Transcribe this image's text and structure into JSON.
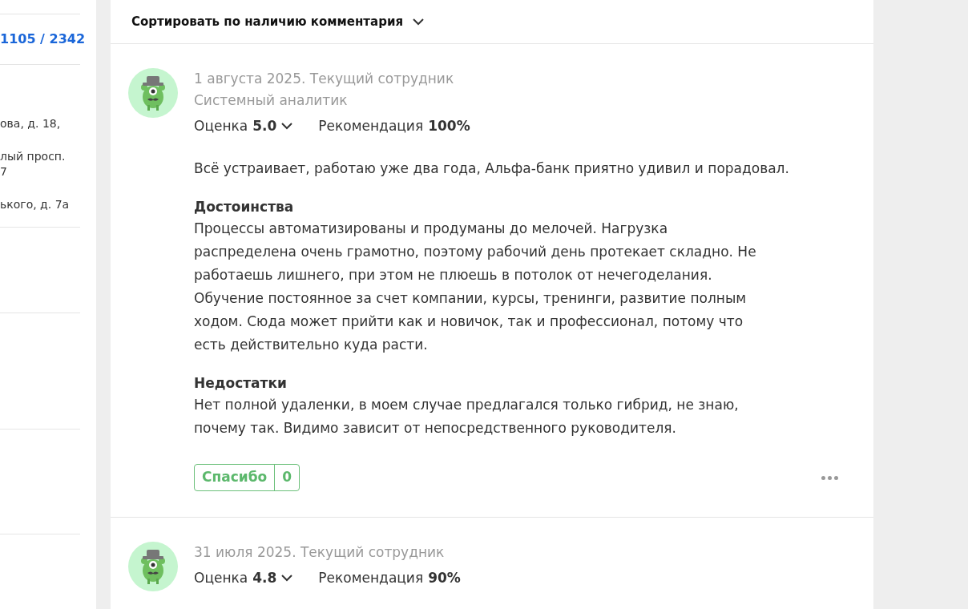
{
  "sidebar": {
    "counter": "1105 / 2342",
    "addresses": [
      "ова, д. 18,",
      "лый просп.\n7",
      "ького, д. 7а"
    ]
  },
  "sort": {
    "label": "Сортировать по наличию комментария"
  },
  "reviews": [
    {
      "date": "1 августа 2025. Текущий сотрудник",
      "position": "Системный аналитик",
      "rating_label": "Оценка",
      "rating": "5.0",
      "recommend_label": "Рекомендация",
      "recommend": "100%",
      "summary": "Всё устраивает, работаю уже два года, Альфа-банк приятно удивил и порадовал.",
      "sections": [
        {
          "title": "Достоинства",
          "text": "Процессы автоматизированы и продуманы до мелочей. Нагрузка распределена очень грамотно, поэтому рабочий день протекает складно. Не работаешь лишнего, при этом не плюешь в потолок от нечегоделания. Обучение постоянное за счет компании, курсы, тренинги, развитие полным ходом. Сюда может прийти как и новичок, так и профессионал, потому что есть действительно куда расти."
        },
        {
          "title": "Недостатки",
          "text": "Нет полной удаленки, в моем случае предлагался только гибрид, не знаю, почему так. Видимо зависит от непосредственного руководителя."
        }
      ],
      "thanks_label": "Спасибо",
      "thanks_count": "0"
    },
    {
      "date": "31 июля 2025. Текущий сотрудник",
      "rating_label": "Оценка",
      "rating": "4.8",
      "recommend_label": "Рекомендация",
      "recommend": "90%"
    }
  ]
}
